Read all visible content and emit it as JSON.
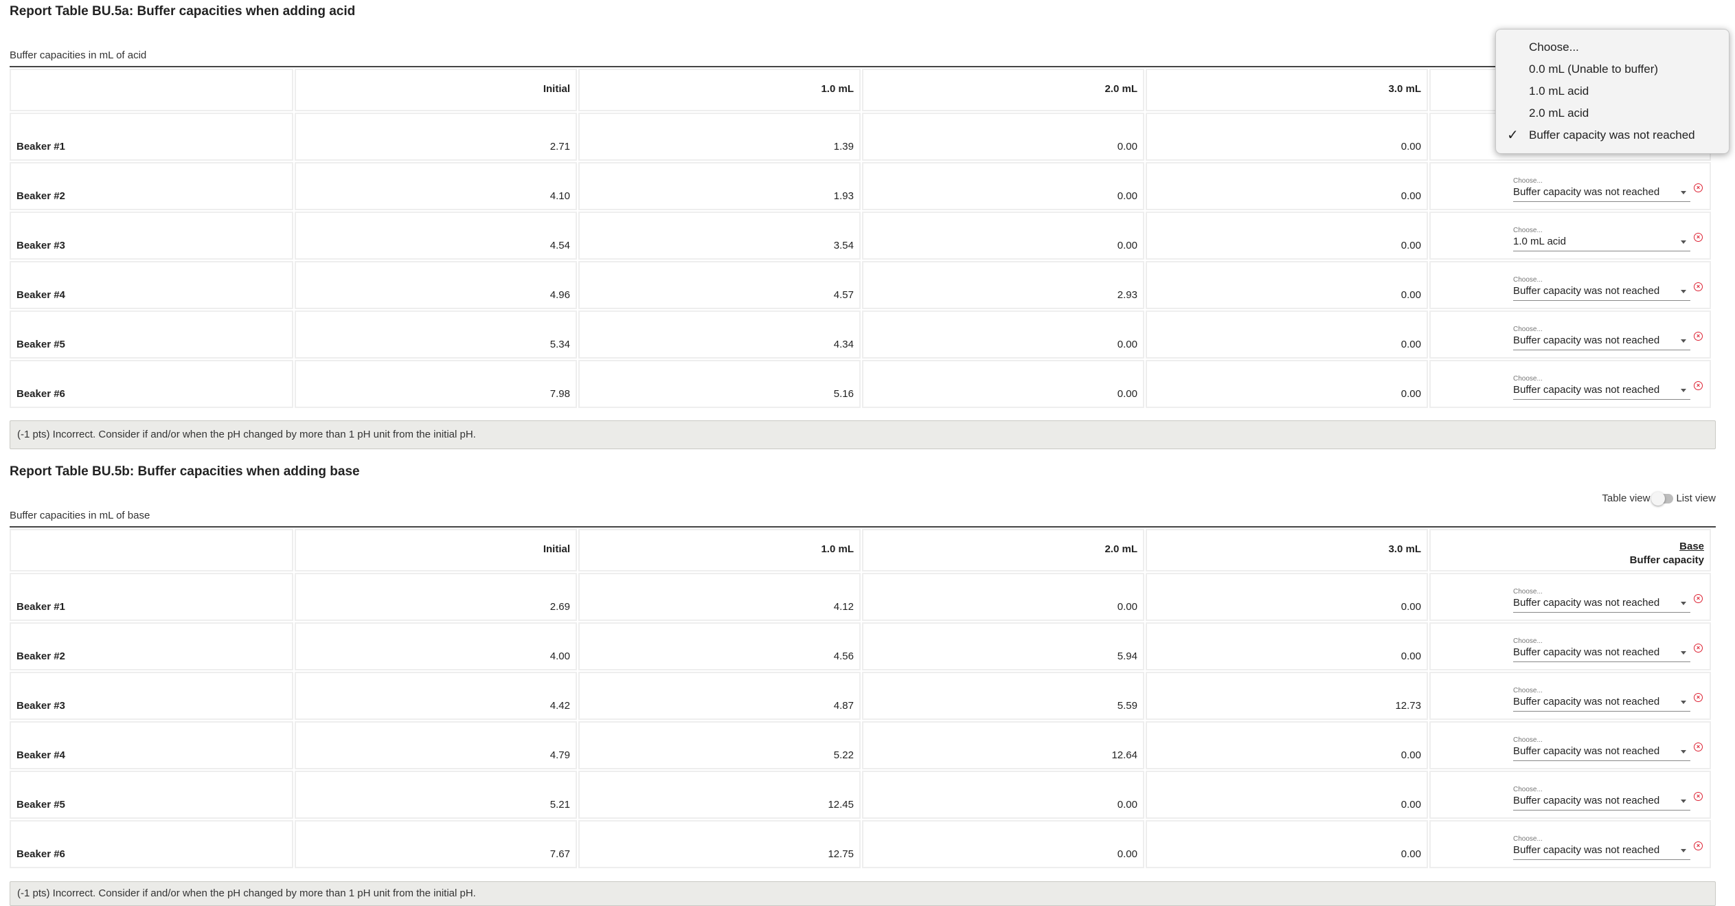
{
  "acid": {
    "title": "Report Table BU.5a: Buffer capacities when adding acid",
    "caption": "Buffer capacities in mL of acid",
    "headers": [
      "",
      "Initial",
      "1.0 mL",
      "2.0 mL",
      "3.0 mL"
    ],
    "select_label": "Choose...",
    "rows": [
      {
        "label": "Beaker #1",
        "values": [
          "2.71",
          "1.39",
          "0.00",
          "0.00"
        ],
        "capacity": ""
      },
      {
        "label": "Beaker #2",
        "values": [
          "4.10",
          "1.93",
          "0.00",
          "0.00"
        ],
        "capacity": "Buffer capacity was not reached"
      },
      {
        "label": "Beaker #3",
        "values": [
          "4.54",
          "3.54",
          "0.00",
          "0.00"
        ],
        "capacity": "1.0 mL acid"
      },
      {
        "label": "Beaker #4",
        "values": [
          "4.96",
          "4.57",
          "2.93",
          "0.00"
        ],
        "capacity": "Buffer capacity was not reached"
      },
      {
        "label": "Beaker #5",
        "values": [
          "5.34",
          "4.34",
          "0.00",
          "0.00"
        ],
        "capacity": "Buffer capacity was not reached"
      },
      {
        "label": "Beaker #6",
        "values": [
          "7.98",
          "5.16",
          "0.00",
          "0.00"
        ],
        "capacity": "Buffer capacity was not reached"
      }
    ],
    "feedback": "(-1 pts) Incorrect. Consider if and/or when the pH changed by more than 1 pH unit from the initial pH."
  },
  "dropdown_menu": {
    "items": [
      "Choose...",
      "0.0 mL (Unable to buffer)",
      "1.0 mL acid",
      "2.0 mL acid",
      "Buffer capacity was not reached"
    ],
    "selected_index": 4
  },
  "base": {
    "title": "Report Table BU.5b: Buffer capacities when adding base",
    "caption": "Buffer capacities in mL of base",
    "toggle_left": "Table view",
    "toggle_right": "List view",
    "headers": [
      "",
      "Initial",
      "1.0 mL",
      "2.0 mL",
      "3.0 mL"
    ],
    "capacity_header_top": "Base",
    "capacity_header_bottom": "Buffer capacity",
    "select_label": "Choose...",
    "rows": [
      {
        "label": "Beaker #1",
        "values": [
          "2.69",
          "4.12",
          "0.00",
          "0.00"
        ],
        "capacity": "Buffer capacity was not reached"
      },
      {
        "label": "Beaker #2",
        "values": [
          "4.00",
          "4.56",
          "5.94",
          "0.00"
        ],
        "capacity": "Buffer capacity was not reached"
      },
      {
        "label": "Beaker #3",
        "values": [
          "4.42",
          "4.87",
          "5.59",
          "12.73"
        ],
        "capacity": "Buffer capacity was not reached"
      },
      {
        "label": "Beaker #4",
        "values": [
          "4.79",
          "5.22",
          "12.64",
          "0.00"
        ],
        "capacity": "Buffer capacity was not reached"
      },
      {
        "label": "Beaker #5",
        "values": [
          "5.21",
          "12.45",
          "0.00",
          "0.00"
        ],
        "capacity": "Buffer capacity was not reached"
      },
      {
        "label": "Beaker #6",
        "values": [
          "7.67",
          "12.75",
          "0.00",
          "0.00"
        ],
        "capacity": "Buffer capacity was not reached"
      }
    ],
    "feedback": "(-1 pts) Incorrect. Consider if and/or when the pH changed by more than 1 pH unit from the initial pH."
  },
  "colors": {
    "feedback_bg": "#ebebe8",
    "clear_icon": "#dd2233",
    "cell_border": "#eeeeee"
  }
}
